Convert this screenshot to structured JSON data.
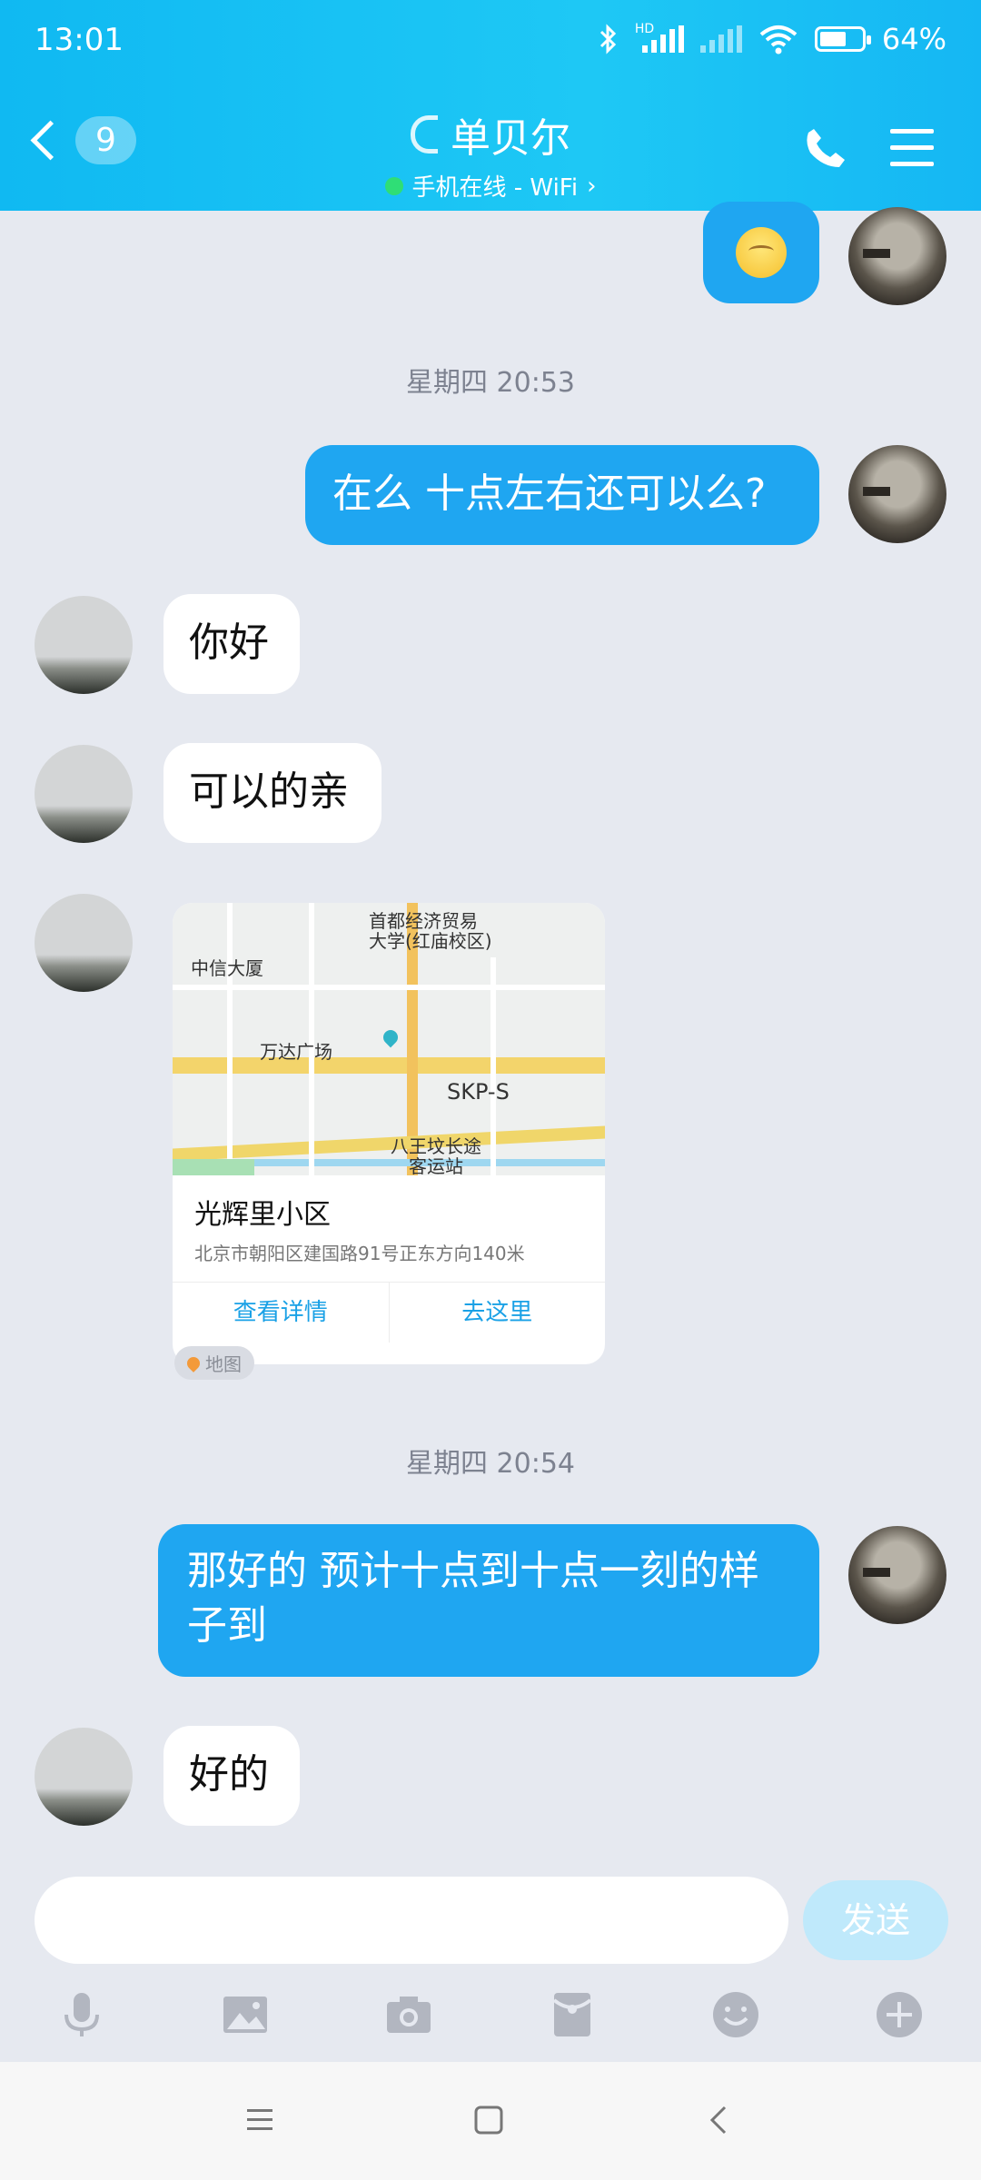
{
  "status": {
    "time": "13:01",
    "battery": "64%",
    "battery_level": 0.64,
    "hd": "HD"
  },
  "header": {
    "unread_count": "9",
    "contact_name": "单贝尔",
    "status_text": "手机在线 - WiFi",
    "chevron": "›"
  },
  "messages": {
    "sep1": "星期四 20:53",
    "m1": "在么 十点左右还可以么?",
    "m2": "你好",
    "m3": "可以的亲",
    "sep2": "星期四 20:54",
    "m4_line1": "那好的 预计十点到十点一刻的样",
    "m4_line2": "子到",
    "m5": "好的"
  },
  "location_card": {
    "place_name": "光辉里小区",
    "address": "北京市朝阳区建国路91号正东方向140米",
    "view_details": "查看详情",
    "go_here": "去这里",
    "tag": "地图",
    "map_labels": {
      "univ1": "首都经济贸易",
      "univ2": "大学(红庙校区)",
      "citic": "中信大厦",
      "wanda": "万达广场",
      "skp": "SKP-S",
      "station1": "八王坟长途",
      "station2": "客运站"
    }
  },
  "input": {
    "send_label": "发送"
  },
  "colors": {
    "accent": "#1fa6f1",
    "header": "#10b9f2",
    "link": "#1aa1e6"
  }
}
